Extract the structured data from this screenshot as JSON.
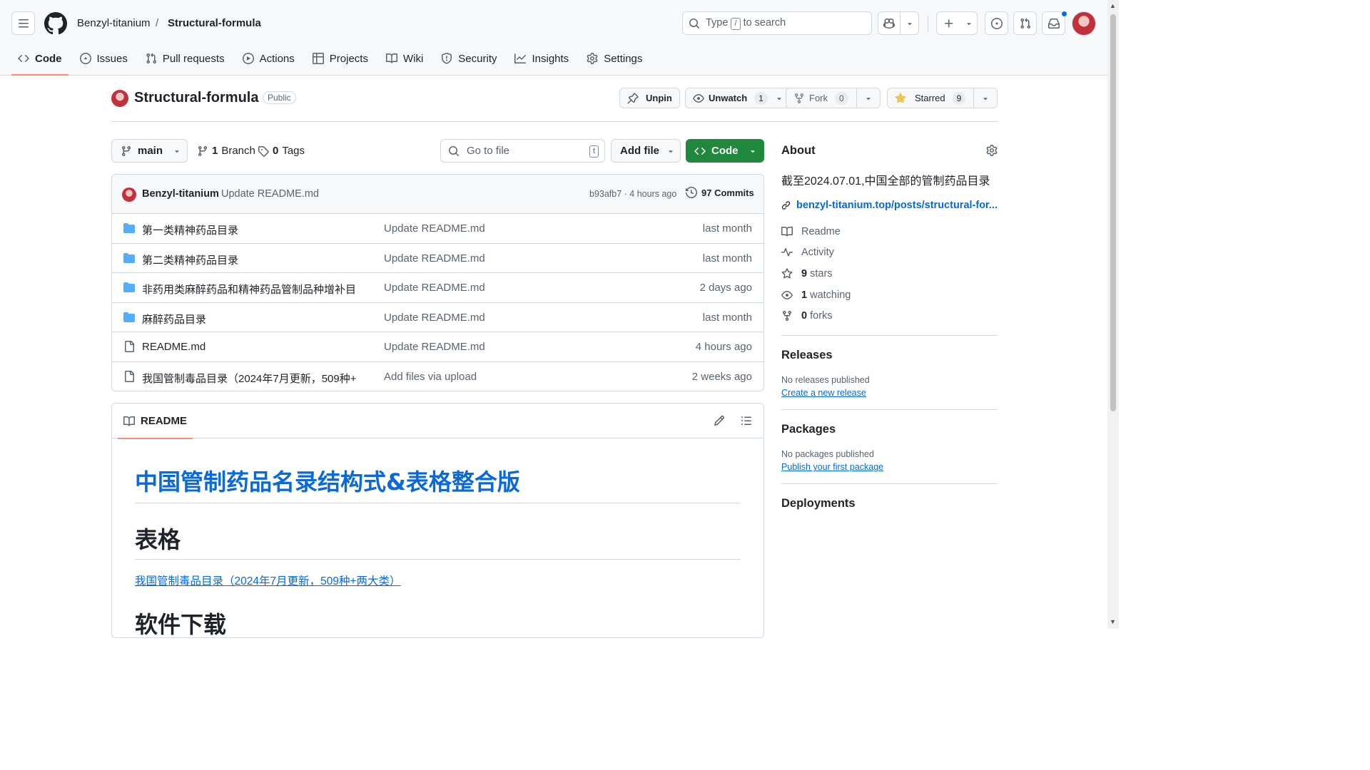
{
  "header": {
    "owner": "Benzyl-titanium",
    "separator": "/",
    "repo": "Structural-formula",
    "search_type": "Type",
    "search_key": "/",
    "search_tail": "to search"
  },
  "tabs": [
    {
      "label": "Code",
      "icon": "code-icon"
    },
    {
      "label": "Issues",
      "icon": "issue-icon"
    },
    {
      "label": "Pull requests",
      "icon": "pull-request-icon"
    },
    {
      "label": "Actions",
      "icon": "play-icon"
    },
    {
      "label": "Projects",
      "icon": "table-icon"
    },
    {
      "label": "Wiki",
      "icon": "book-icon"
    },
    {
      "label": "Security",
      "icon": "shield-icon"
    },
    {
      "label": "Insights",
      "icon": "graph-icon"
    },
    {
      "label": "Settings",
      "icon": "gear-icon"
    }
  ],
  "repo": {
    "name": "Structural-formula",
    "visibility": "Public",
    "unpin": "Unpin",
    "unwatch": "Unwatch",
    "watch_count": "1",
    "fork": "Fork",
    "fork_count": "0",
    "starred": "Starred",
    "star_count": "9"
  },
  "toolbar": {
    "branch": "main",
    "branch_count": "1",
    "branch_label": "Branch",
    "tag_count": "0",
    "tag_label": "Tags",
    "goto_placeholder": "Go to file",
    "goto_key": "t",
    "add_file": "Add file",
    "code": "Code"
  },
  "commit": {
    "author": "Benzyl-titanium",
    "message": "Update README.md",
    "hash_time": "b93afb7 · 4 hours ago",
    "commits": "97 Commits"
  },
  "files": [
    {
      "type": "folder",
      "name": "第一类精神药品目录",
      "message": "Update README.md",
      "age": "last month"
    },
    {
      "type": "folder",
      "name": "第二类精神药品目录",
      "message": "Update README.md",
      "age": "last month"
    },
    {
      "type": "folder",
      "name": "非药用类麻醉药品和精神药品管制品种增补目录",
      "message": "Update README.md",
      "age": "2 days ago"
    },
    {
      "type": "folder",
      "name": "麻醉药品目录",
      "message": "Update README.md",
      "age": "last month"
    },
    {
      "type": "file",
      "name": "README.md",
      "message": "Update README.md",
      "age": "4 hours ago"
    },
    {
      "type": "file",
      "name": "我国管制毒品目录（2024年7月更新，509种+...",
      "message": "Add files via upload",
      "age": "2 weeks ago"
    }
  ],
  "readme": {
    "tab": "README",
    "h1": "中国管制药品名录结构式&表格整合版",
    "h2_table": "表格",
    "link": "我国管制毒品目录（2024年7月更新，509种+两大类）",
    "h2_software": "软件下载"
  },
  "about": {
    "title": "About",
    "description": "截至2024.07.01,中国全部的管制药品目录",
    "website": "benzyl-titanium.top/posts/structural-for...",
    "items": [
      {
        "icon": "book-icon",
        "bold": "",
        "text": "Readme"
      },
      {
        "icon": "pulse-icon",
        "bold": "",
        "text": "Activity"
      },
      {
        "icon": "star-icon",
        "bold": "9",
        "text": " stars"
      },
      {
        "icon": "eye-icon",
        "bold": "1",
        "text": " watching"
      },
      {
        "icon": "fork-icon",
        "bold": "0",
        "text": " forks"
      }
    ]
  },
  "releases": {
    "title": "Releases",
    "empty": "No releases published",
    "link": "Create a new release"
  },
  "packages": {
    "title": "Packages",
    "empty": "No packages published",
    "link": "Publish your first package"
  },
  "deployments": {
    "title": "Deployments"
  },
  "colors": {
    "accent": "#0969da",
    "green": "#1f883d",
    "tab_underline": "#fd8c73",
    "folder": "#54aeff"
  }
}
